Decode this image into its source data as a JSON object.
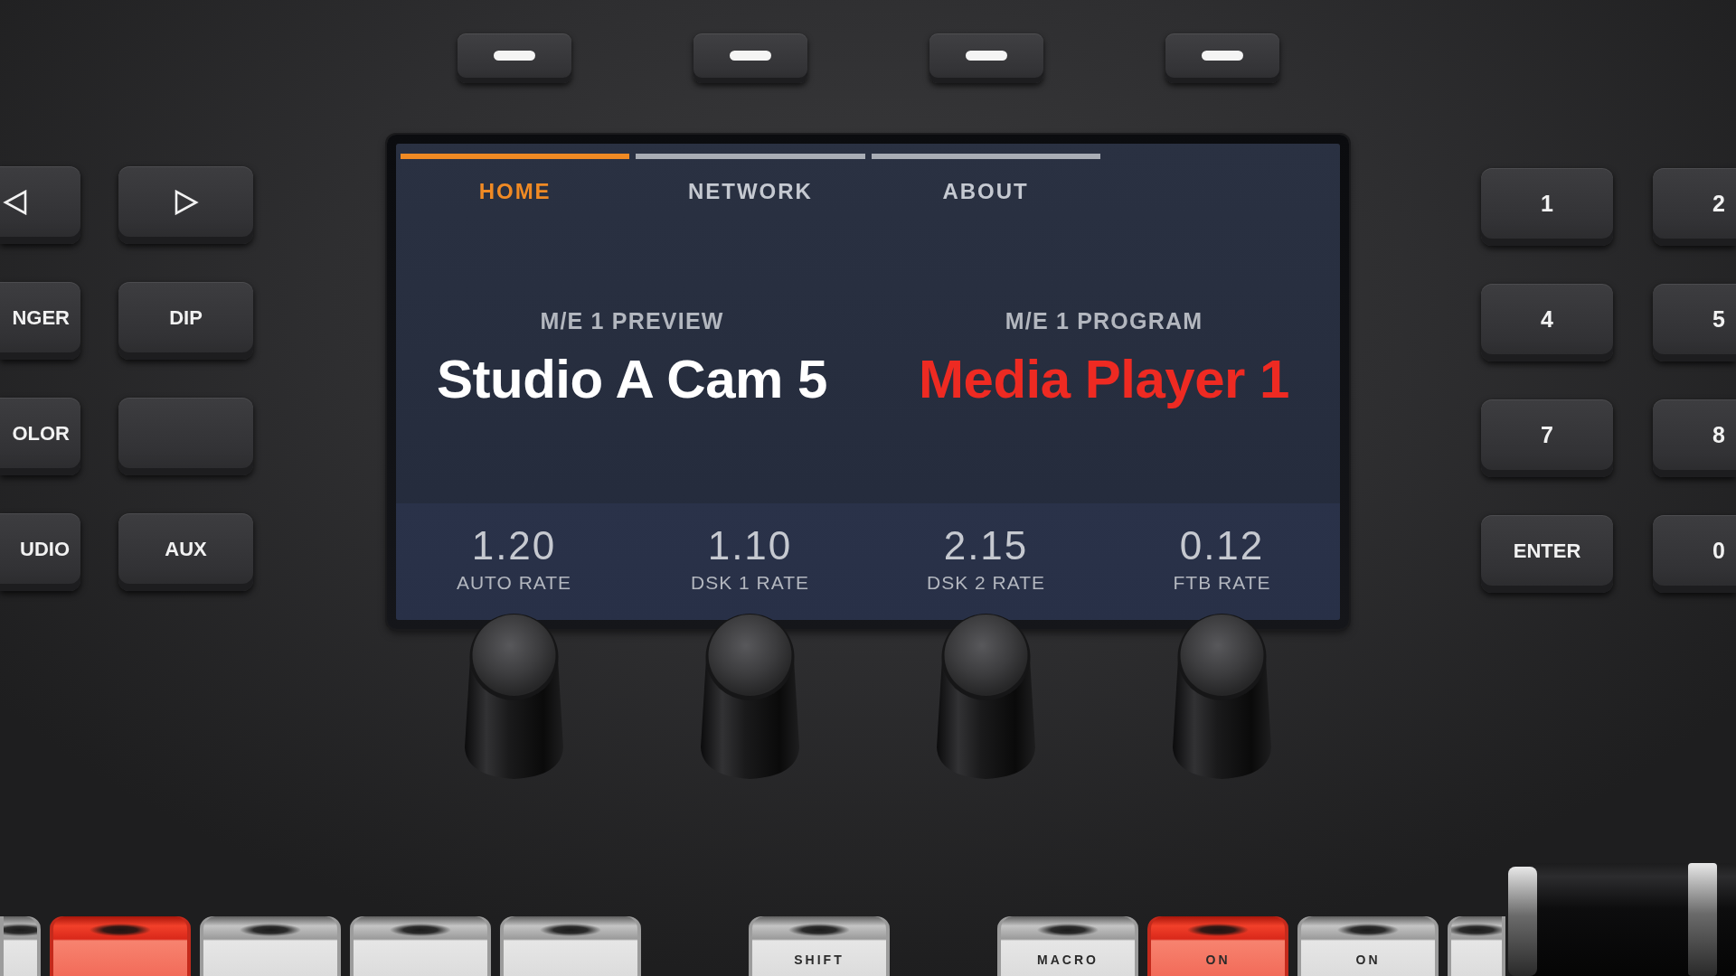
{
  "screen": {
    "tabs": [
      {
        "label": "HOME",
        "selected": true
      },
      {
        "label": "NETWORK",
        "selected": false
      },
      {
        "label": "ABOUT",
        "selected": false
      }
    ],
    "buses": [
      {
        "kind": "preview",
        "label": "M/E 1 PREVIEW",
        "source": "Studio A Cam 5"
      },
      {
        "kind": "program",
        "label": "M/E 1 PROGRAM",
        "source": "Media Player 1"
      }
    ],
    "rates": [
      {
        "value": "1.20",
        "label": "AUTO RATE"
      },
      {
        "value": "1.10",
        "label": "DSK 1 RATE"
      },
      {
        "value": "2.15",
        "label": "DSK 2 RATE"
      },
      {
        "value": "0.12",
        "label": "FTB RATE"
      }
    ]
  },
  "left_key_rows": [
    {
      "keys": [
        {
          "kind": "arrow_left"
        },
        {
          "kind": "arrow_right"
        }
      ]
    },
    {
      "keys": [
        {
          "kind": "text",
          "label": "NGER"
        },
        {
          "kind": "text",
          "label": "DIP"
        }
      ]
    },
    {
      "keys": [
        {
          "kind": "text",
          "label": "OLOR"
        },
        {
          "kind": "blank"
        }
      ]
    },
    {
      "keys": [
        {
          "kind": "text",
          "label": "UDIO"
        },
        {
          "kind": "text",
          "label": "AUX"
        }
      ]
    }
  ],
  "number_key_rows": [
    {
      "keys": [
        {
          "label": "1"
        },
        {
          "label": "2"
        }
      ]
    },
    {
      "keys": [
        {
          "label": "4"
        },
        {
          "label": "5"
        }
      ]
    },
    {
      "keys": [
        {
          "label": "7"
        },
        {
          "label": "8"
        }
      ]
    },
    {
      "keys": [
        {
          "label": "ENTER"
        },
        {
          "label": "0"
        }
      ]
    }
  ],
  "bottom_key_banks": [
    {
      "keys": [
        {
          "lit": false
        },
        {
          "lit": true
        },
        {
          "lit": false
        },
        {
          "lit": false
        },
        {
          "lit": false
        }
      ]
    },
    {
      "keys": [
        {
          "label": "SHIFT",
          "lit": false
        }
      ]
    },
    {
      "keys": [
        {
          "label": "MACRO",
          "lit": false
        },
        {
          "label": "ON",
          "lit": true
        },
        {
          "label": "ON",
          "lit": false
        },
        {
          "lit": false
        }
      ]
    }
  ]
}
